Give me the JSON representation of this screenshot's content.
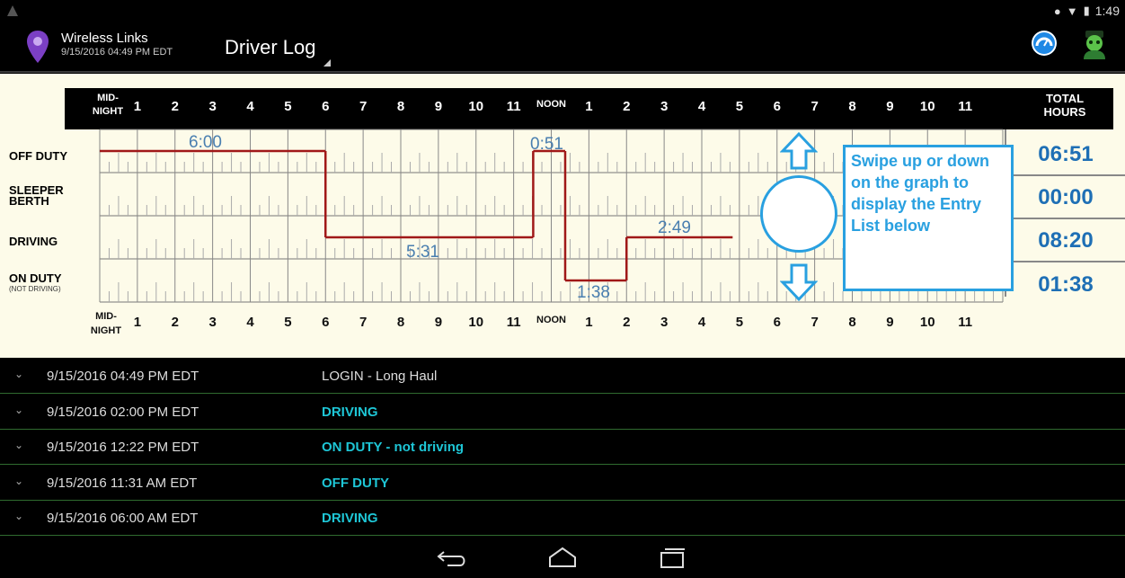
{
  "status_bar": {
    "time": "1:49"
  },
  "action_bar": {
    "app_name": "Wireless Links",
    "app_date": "9/15/2016 04:49 PM EDT",
    "title": "Driver Log",
    "icons": [
      "location-pin-icon",
      "gauge-icon",
      "driver-avatar-icon"
    ]
  },
  "graph": {
    "hours_top": [
      "1",
      "2",
      "3",
      "4",
      "5",
      "6",
      "7",
      "8",
      "9",
      "10",
      "11",
      "NOON",
      "1",
      "2",
      "3",
      "4",
      "5",
      "6",
      "7",
      "8",
      "9",
      "10",
      "11"
    ],
    "midnight_label_line1": "MID-",
    "midnight_label_line2": "NIGHT",
    "total_header_line1": "TOTAL",
    "total_header_line2": "HOURS",
    "rows": [
      {
        "label": "OFF DUTY",
        "sub": ""
      },
      {
        "label": "SLEEPER",
        "label2": "BERTH",
        "sub": ""
      },
      {
        "label": "DRIVING",
        "sub": ""
      },
      {
        "label": "ON DUTY",
        "sub": "(NOT DRIVING)"
      }
    ],
    "totals": [
      "06:51",
      "00:00",
      "08:20",
      "01:38"
    ],
    "duration_labels": [
      "6:00",
      "0:51",
      "5:31",
      "2:49",
      "1:38"
    ],
    "callout_text": "Swipe up or down on the graph to display the Entry List below"
  },
  "chart_data": {
    "type": "line",
    "title": "",
    "x_unit": "hour of day",
    "xlim": [
      0,
      24
    ],
    "categories": [
      "OFF DUTY",
      "SLEEPER BERTH",
      "DRIVING",
      "ON DUTY (NOT DRIVING)"
    ],
    "segments": [
      {
        "status": "OFF DUTY",
        "start": 0.0,
        "end": 6.0
      },
      {
        "status": "DRIVING",
        "start": 6.0,
        "end": 11.52
      },
      {
        "status": "OFF DUTY",
        "start": 11.52,
        "end": 12.37
      },
      {
        "status": "ON DUTY (NOT DRIVING)",
        "start": 12.37,
        "end": 14.0
      },
      {
        "status": "DRIVING",
        "start": 14.0,
        "end": 16.82
      }
    ]
  },
  "entries": [
    {
      "date": "9/15/2016 04:49 PM EDT",
      "status": "LOGIN - Long Haul",
      "accent": false
    },
    {
      "date": "9/15/2016 02:00 PM EDT",
      "status": "DRIVING",
      "accent": true
    },
    {
      "date": "9/15/2016 12:22 PM EDT",
      "status": "ON DUTY - not driving",
      "accent": true
    },
    {
      "date": "9/15/2016 11:31 AM EDT",
      "status": "OFF DUTY",
      "accent": true
    },
    {
      "date": "9/15/2016 06:00 AM EDT",
      "status": "DRIVING",
      "accent": true
    }
  ],
  "colors": {
    "accent_cyan": "#1ec6d6",
    "total_blue": "#1e6fb5",
    "log_line": "#a01818",
    "callout_blue": "#29a0e0"
  }
}
